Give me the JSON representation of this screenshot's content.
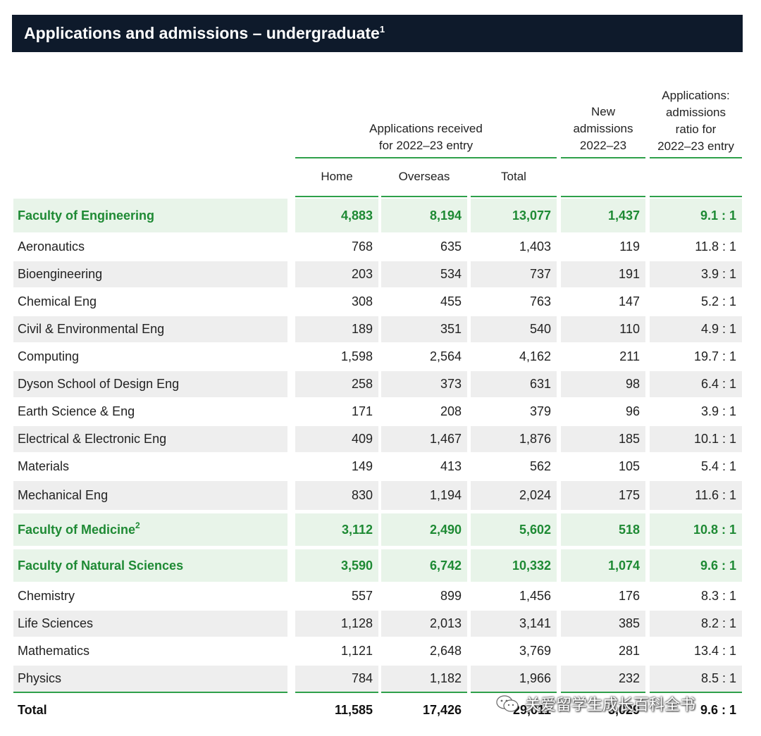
{
  "title": {
    "text": "Applications and admissions – undergraduate",
    "footnote": "1"
  },
  "headers": {
    "applications_received": [
      "Applications received",
      "for 2022–23 entry"
    ],
    "new_admissions": [
      "New",
      "admissions",
      "2022–23"
    ],
    "ratio": [
      "Applications:",
      "admissions",
      "ratio for",
      "2022–23 entry"
    ],
    "home": "Home",
    "overseas": "Overseas",
    "total": "Total"
  },
  "rows": [
    {
      "name": "Faculty of Engineering",
      "footnote": "",
      "home": "4,883",
      "overseas": "8,194",
      "total": "13,077",
      "new_admissions": "1,437",
      "ratio": "9.1 : 1"
    },
    {
      "name": "Aeronautics",
      "home": "768",
      "overseas": "635",
      "total": "1,403",
      "new_admissions": "119",
      "ratio": "11.8 : 1"
    },
    {
      "name": "Bioengineering",
      "home": "203",
      "overseas": "534",
      "total": "737",
      "new_admissions": "191",
      "ratio": "3.9 : 1"
    },
    {
      "name": "Chemical Eng",
      "home": "308",
      "overseas": "455",
      "total": "763",
      "new_admissions": "147",
      "ratio": "5.2 : 1"
    },
    {
      "name": "Civil & Environmental Eng",
      "home": "189",
      "overseas": "351",
      "total": "540",
      "new_admissions": "110",
      "ratio": "4.9 : 1"
    },
    {
      "name": "Computing",
      "home": "1,598",
      "overseas": "2,564",
      "total": "4,162",
      "new_admissions": "211",
      "ratio": "19.7 : 1"
    },
    {
      "name": "Dyson School of Design Eng",
      "home": "258",
      "overseas": "373",
      "total": "631",
      "new_admissions": "98",
      "ratio": "6.4 : 1"
    },
    {
      "name": "Earth Science & Eng",
      "home": "171",
      "overseas": "208",
      "total": "379",
      "new_admissions": "96",
      "ratio": "3.9 : 1"
    },
    {
      "name": "Electrical & Electronic Eng",
      "home": "409",
      "overseas": "1,467",
      "total": "1,876",
      "new_admissions": "185",
      "ratio": "10.1 : 1"
    },
    {
      "name": "Materials",
      "home": "149",
      "overseas": "413",
      "total": "562",
      "new_admissions": "105",
      "ratio": "5.4 : 1"
    },
    {
      "name": "Mechanical Eng",
      "home": "830",
      "overseas": "1,194",
      "total": "2,024",
      "new_admissions": "175",
      "ratio": "11.6 : 1"
    },
    {
      "name": "Faculty of Medicine",
      "footnote": "2",
      "home": "3,112",
      "overseas": "2,490",
      "total": "5,602",
      "new_admissions": "518",
      "ratio": "10.8 : 1"
    },
    {
      "name": "Faculty of Natural Sciences",
      "footnote": "",
      "home": "3,590",
      "overseas": "6,742",
      "total": "10,332",
      "new_admissions": "1,074",
      "ratio": "9.6 : 1"
    },
    {
      "name": "Chemistry",
      "home": "557",
      "overseas": "899",
      "total": "1,456",
      "new_admissions": "176",
      "ratio": "8.3 : 1"
    },
    {
      "name": "Life Sciences",
      "home": "1,128",
      "overseas": "2,013",
      "total": "3,141",
      "new_admissions": "385",
      "ratio": "8.2 : 1"
    },
    {
      "name": "Mathematics",
      "home": "1,121",
      "overseas": "2,648",
      "total": "3,769",
      "new_admissions": "281",
      "ratio": "13.4 : 1"
    },
    {
      "name": "Physics",
      "home": "784",
      "overseas": "1,182",
      "total": "1,966",
      "new_admissions": "232",
      "ratio": "8.5 : 1"
    },
    {
      "name": "Total",
      "home": "11,585",
      "overseas": "17,426",
      "total": "29,011",
      "new_admissions": "3,029",
      "ratio": "9.6 : 1"
    }
  ],
  "watermark": {
    "text": "关爱留学生成长百科全书",
    "icon": "wechat-icon"
  },
  "colors": {
    "title_bg": "#0e1a2b",
    "accent_green": "#2ea04a",
    "faculty_text": "#1e8a34",
    "faculty_bg": "#e8f4e9",
    "row_shade": "#eeeeee"
  }
}
